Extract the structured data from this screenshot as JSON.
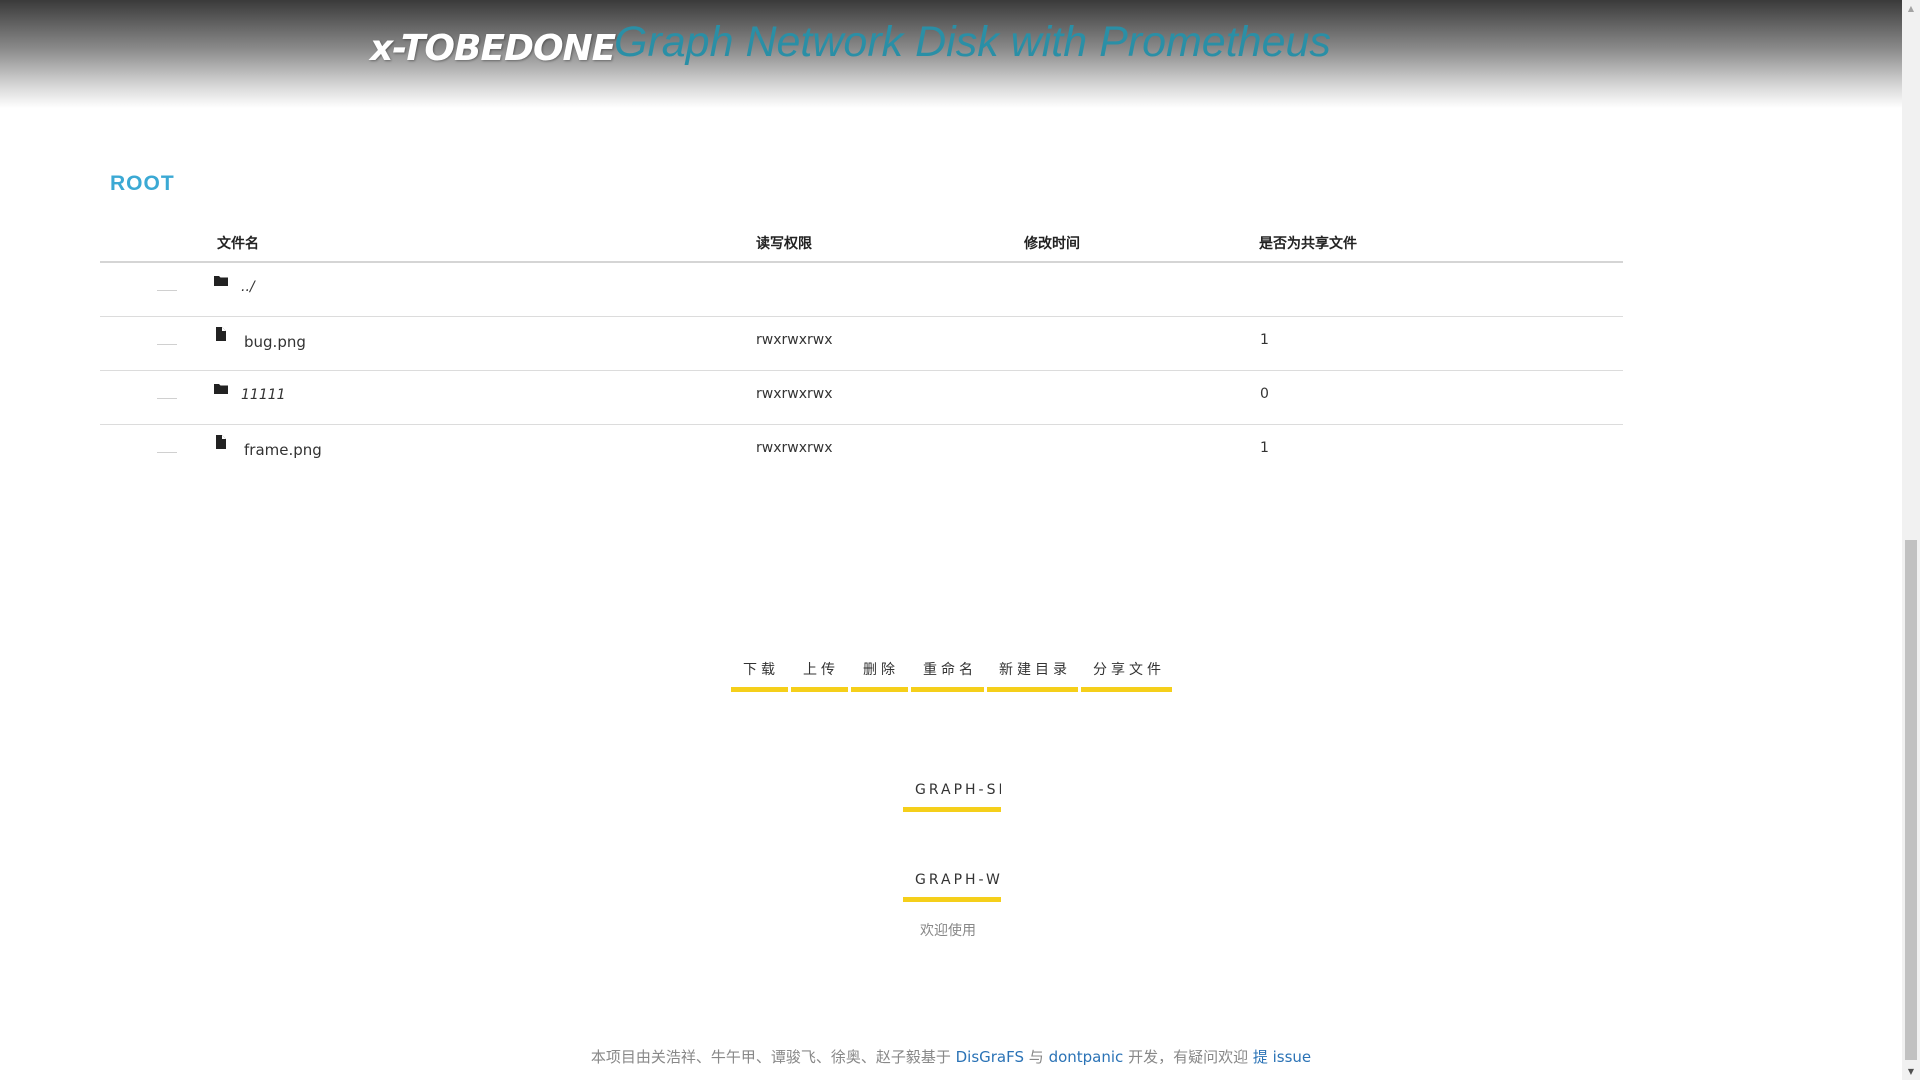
{
  "header": {
    "logo": "x-TOBEDONE",
    "title": "Graph Network Disk with Prometheus"
  },
  "breadcrumb": "ROOT",
  "table": {
    "columns": [
      "文件名",
      "读写权限",
      "修改时间",
      "是否为共享文件"
    ],
    "rows": [
      {
        "icon": "folder-icon",
        "name": "../",
        "permission": "",
        "mtime": "",
        "shared": ""
      },
      {
        "icon": "file-icon",
        "name": "bug.png",
        "permission": "rwxrwxrwx",
        "mtime": "",
        "shared": "1"
      },
      {
        "icon": "folder-icon",
        "name": "11111",
        "permission": "rwxrwxrwx",
        "mtime": "",
        "shared": "0"
      },
      {
        "icon": "file-icon",
        "name": "frame.png",
        "permission": "rwxrwxrwx",
        "mtime": "",
        "shared": "1"
      }
    ]
  },
  "actions": {
    "download": "下载",
    "upload": "上传",
    "delete": "删除",
    "rename": "重命名",
    "new_dir": "新建目录",
    "share": "分享文件"
  },
  "graph_buttons": {
    "graph_s": "GRAPH-SE",
    "graph_w": "GRAPH-W"
  },
  "welcome": "欢迎使用",
  "footer": {
    "prefix": "本项目由关浩祥、牛午甲、谭骏飞、徐奥、赵子毅基于 ",
    "link1": "DisGraFS",
    "mid1": " 与 ",
    "link2": "dontpanic",
    "mid2": " 开发，有疑问欢迎 ",
    "link3": "提 issue"
  },
  "colors": {
    "accent_yellow": "#f5cf1a",
    "title_teal": "#2a8fa6",
    "crumb_blue": "#3ba9d4",
    "link_blue": "#2b73b6"
  }
}
